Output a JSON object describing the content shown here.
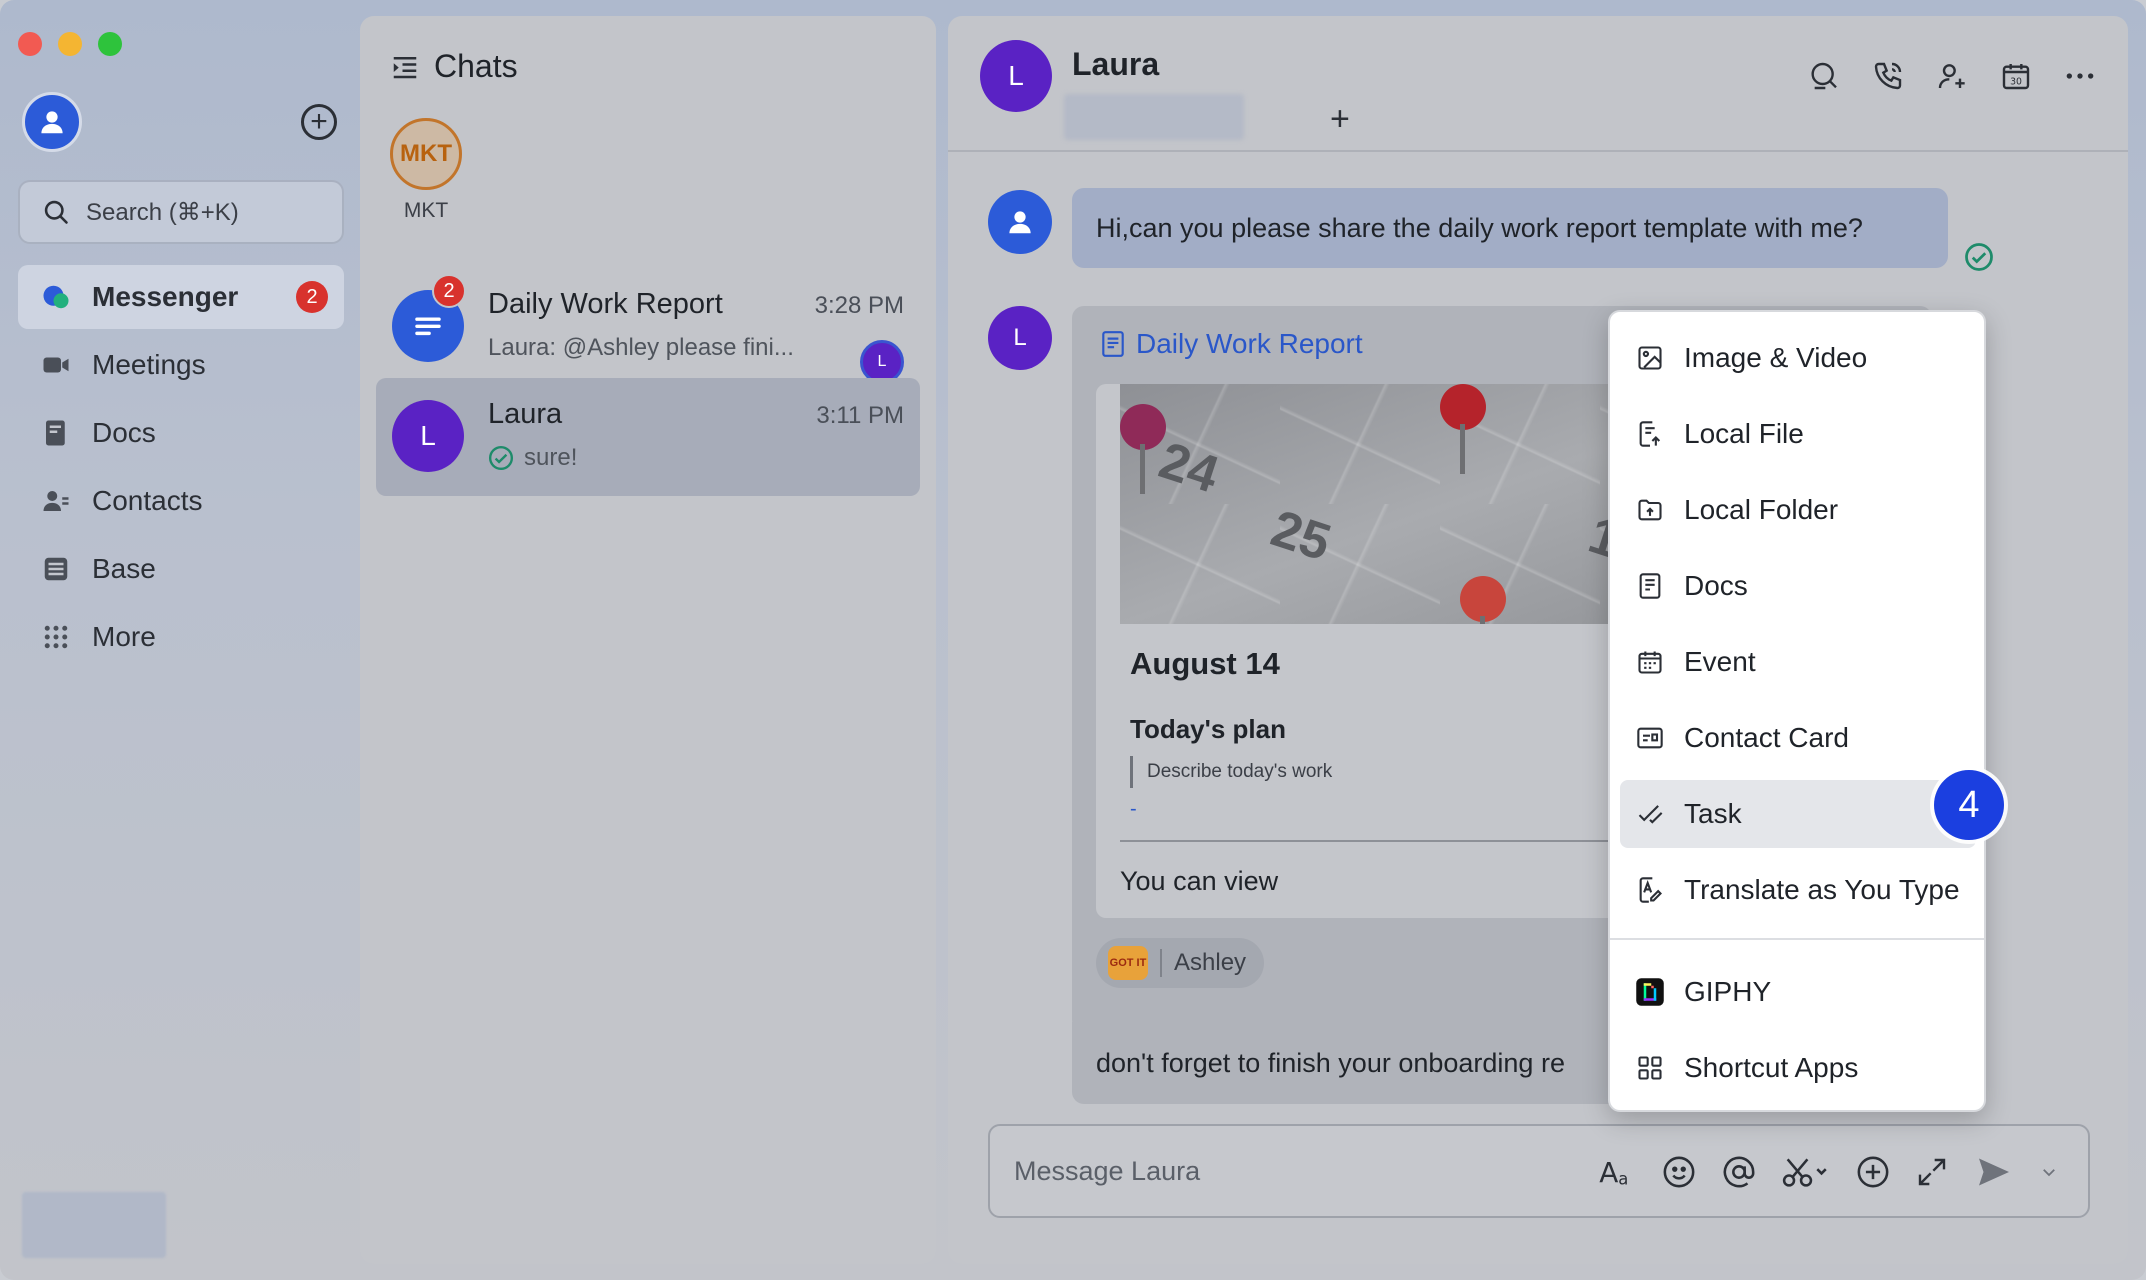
{
  "colors": {
    "accent": "#2a57c9",
    "badge_red": "#d8322d",
    "avatar_purple": "#5a22c4",
    "step_blue": "#1b3fe0"
  },
  "sidebar": {
    "search_placeholder": "Search (⌘+K)",
    "items": [
      {
        "label": "Messenger",
        "icon": "messenger-icon",
        "badge": "2",
        "active": true
      },
      {
        "label": "Meetings",
        "icon": "video-camera-icon"
      },
      {
        "label": "Docs",
        "icon": "docs-icon"
      },
      {
        "label": "Contacts",
        "icon": "contacts-icon"
      },
      {
        "label": "Base",
        "icon": "base-icon"
      },
      {
        "label": "More",
        "icon": "grid-dots-icon"
      }
    ]
  },
  "chats": {
    "title": "Chats",
    "pinned_group": {
      "avatar_text": "MKT",
      "label": "MKT"
    },
    "list": [
      {
        "name": "Daily Work Report",
        "time": "3:28 PM",
        "preview": "Laura: @Ashley please fini...",
        "badge": "2",
        "mini_avatar": "L"
      },
      {
        "name": "Laura",
        "avatar": "L",
        "time": "3:11 PM",
        "preview": "sure!"
      }
    ]
  },
  "conversation": {
    "name": "Laura",
    "avatar": "L",
    "add_tab": "+",
    "messages": {
      "outgoing": "Hi,can you please share the daily work report template with me?",
      "card": {
        "title": "Daily Work Report",
        "image_numbers": [
          "24",
          "25",
          "1"
        ],
        "date": "August 14",
        "plan_heading": "Today's plan",
        "plan_desc": "Describe today's work",
        "dash": "-",
        "view_text": "You can view",
        "reaction_emoji_text": "GOT IT",
        "reaction_user": "Ashley"
      },
      "incoming_text": "don't forget to finish your onboarding re"
    },
    "composer_placeholder": "Message Laura"
  },
  "menu": {
    "items": [
      {
        "label": "Image & Video",
        "icon": "image-icon"
      },
      {
        "label": "Local File",
        "icon": "file-upload-icon"
      },
      {
        "label": "Local Folder",
        "icon": "folder-upload-icon"
      },
      {
        "label": "Docs",
        "icon": "docs-icon"
      },
      {
        "label": "Event",
        "icon": "calendar-icon"
      },
      {
        "label": "Contact Card",
        "icon": "contact-card-icon"
      },
      {
        "label": "Task",
        "icon": "task-check-icon",
        "highlighted": true
      },
      {
        "label": "Translate as You Type",
        "icon": "translate-icon"
      },
      {
        "label": "GIPHY",
        "icon": "giphy-icon"
      },
      {
        "label": "Shortcut Apps",
        "icon": "apps-grid-icon"
      }
    ],
    "step_badge": "4"
  }
}
